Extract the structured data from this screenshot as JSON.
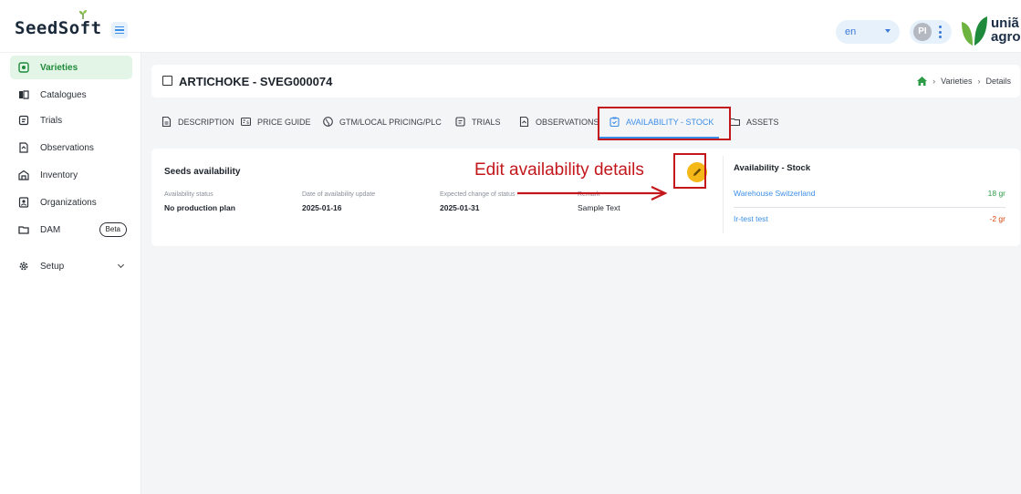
{
  "app": {
    "logo_text": "SeedSoft",
    "brand_text": "uniã agro"
  },
  "topbar": {
    "language": "en",
    "user_initials": "PI"
  },
  "sidebar": {
    "items": [
      {
        "label": "Varieties",
        "icon": "varieties-icon",
        "active": true
      },
      {
        "label": "Catalogues",
        "icon": "catalogue-icon"
      },
      {
        "label": "Trials",
        "icon": "trials-icon"
      },
      {
        "label": "Observations",
        "icon": "observations-icon"
      },
      {
        "label": "Inventory",
        "icon": "inventory-icon"
      },
      {
        "label": "Organizations",
        "icon": "organizations-icon"
      },
      {
        "label": "DAM",
        "icon": "folder-icon",
        "badge": "Beta"
      },
      {
        "label": "Setup",
        "icon": "gear-icon",
        "expandable": true
      }
    ]
  },
  "page": {
    "title": "ARTICHOKE - SVEG000074",
    "breadcrumb": [
      "Varieties",
      "Details"
    ]
  },
  "tabs": [
    {
      "label": "DESCRIPTION",
      "icon": "document-icon"
    },
    {
      "label": "PRICE GUIDE",
      "icon": "price-tag-icon"
    },
    {
      "label": "GTM/LOCAL PRICING/PLC",
      "icon": "globe-icon"
    },
    {
      "label": "TRIALS",
      "icon": "trials-icon"
    },
    {
      "label": "OBSERVATIONS",
      "icon": "observations-icon"
    },
    {
      "label": "AVAILABILITY - STOCK",
      "icon": "clipboard-icon",
      "active": true
    },
    {
      "label": "ASSETS",
      "icon": "folder-icon"
    }
  ],
  "seeds_availability": {
    "title": "Seeds availability",
    "fields": [
      {
        "label": "Availability status",
        "value": "No production plan"
      },
      {
        "label": "Date of availability update",
        "value": "2025-01-16"
      },
      {
        "label": "Expected change of status",
        "value": "2025-01-31"
      },
      {
        "label": "Remark",
        "value": "Sample Text"
      }
    ]
  },
  "stock": {
    "title": "Availability - Stock",
    "rows": [
      {
        "location": "Warehouse Switzerland",
        "quantity": "18 gr",
        "color": "#2e9b47"
      },
      {
        "location": "Ir-test test",
        "quantity": "-2 gr",
        "color": "#d9480f"
      }
    ]
  },
  "annotation": {
    "text": "Edit availability details",
    "color": "#c3171c"
  }
}
